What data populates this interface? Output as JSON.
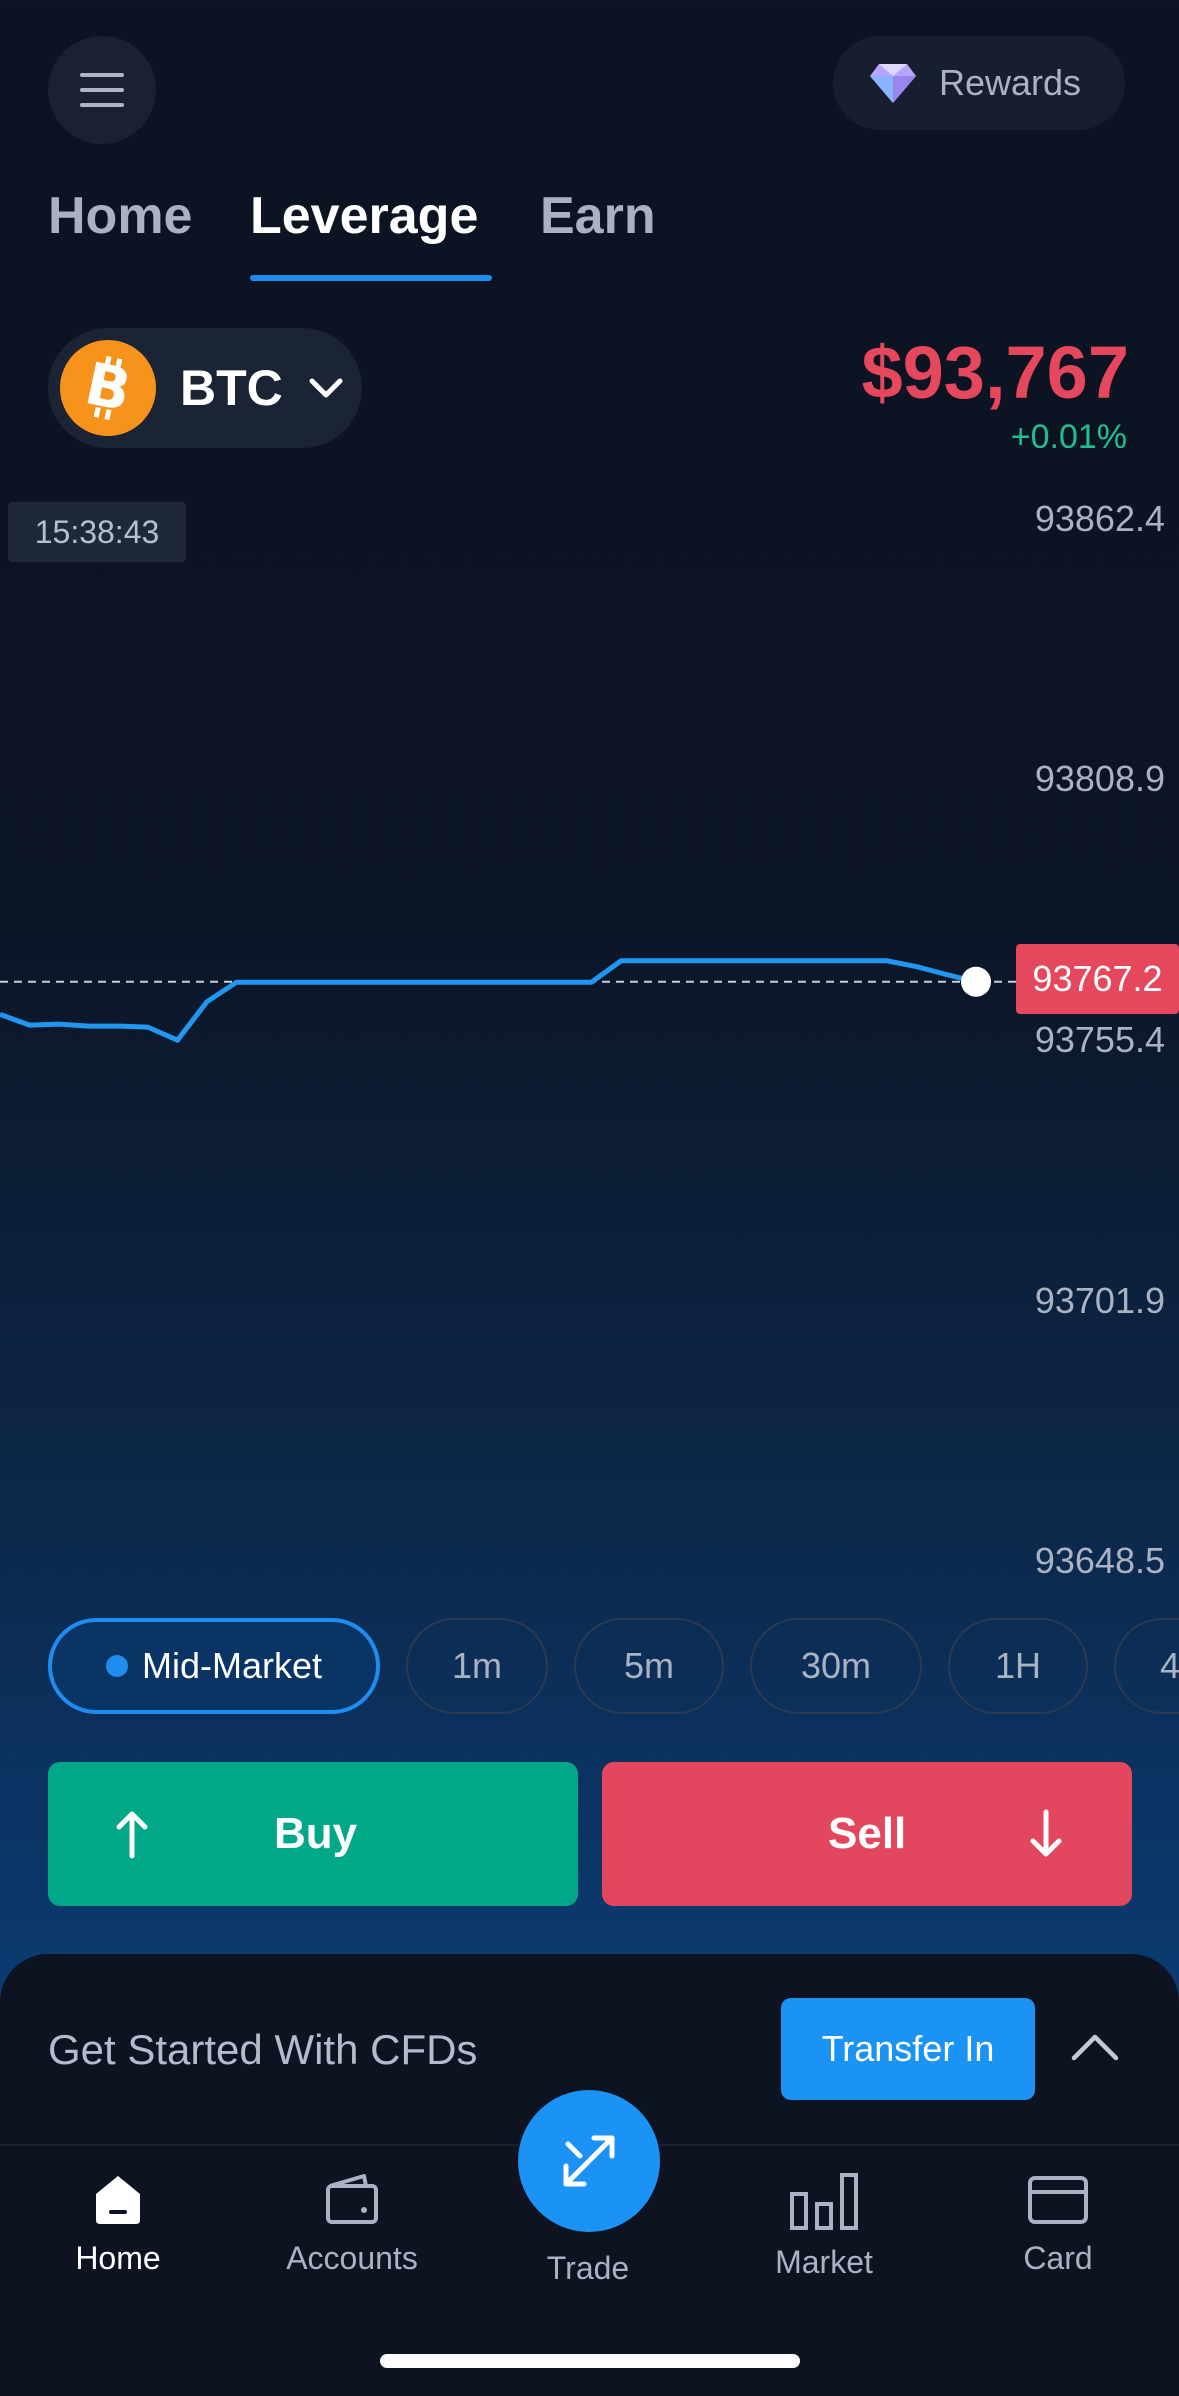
{
  "header": {
    "rewards_label": "Rewards"
  },
  "tabs": [
    {
      "label": "Home"
    },
    {
      "label": "Leverage",
      "active": true
    },
    {
      "label": "Earn"
    }
  ],
  "asset": {
    "symbol": "BTC",
    "price": "$93,767",
    "change": "+0.01%",
    "price_color": "#e5475d",
    "change_color": "#1fbf90"
  },
  "chart": {
    "time_label": "15:38:43",
    "current_price_tag": "93767.2",
    "y_ticks": [
      "93862.4",
      "93808.9",
      "93755.4",
      "93701.9",
      "93648.5"
    ]
  },
  "chart_data": {
    "type": "line",
    "ylim": [
      93648.5,
      93862.4
    ],
    "series": [
      {
        "values": [
          93760.5,
          93758.3,
          93758.5,
          93758.1,
          93758.1,
          93757.9,
          93755.2,
          93763.1,
          93767.1,
          93767.1,
          93767.1,
          93767.1,
          93767.1,
          93767.1,
          93767.1,
          93767.1,
          93767.1,
          93767.1,
          93767.1,
          93767.1,
          93767.1,
          93771.5,
          93771.5,
          93771.5,
          93771.5,
          93771.5,
          93771.5,
          93771.5,
          93771.5,
          93771.5,
          93771.5,
          93770.3,
          93768.7,
          93767.2
        ]
      }
    ],
    "reference_line": 93767.2
  },
  "timeframes": [
    {
      "label": "Mid-Market",
      "active": true
    },
    {
      "label": "1m"
    },
    {
      "label": "5m"
    },
    {
      "label": "30m"
    },
    {
      "label": "1H"
    },
    {
      "label": "4"
    }
  ],
  "actions": {
    "buy": "Buy",
    "sell": "Sell"
  },
  "sheet": {
    "title": "Get Started With CFDs",
    "transfer_label": "Transfer In"
  },
  "nav": {
    "home": "Home",
    "accounts": "Accounts",
    "trade": "Trade",
    "market": "Market",
    "card": "Card"
  },
  "colors": {
    "accent": "#1f8cf0",
    "buy": "#00a788",
    "sell": "#e2475d",
    "line": "#2196f3"
  }
}
